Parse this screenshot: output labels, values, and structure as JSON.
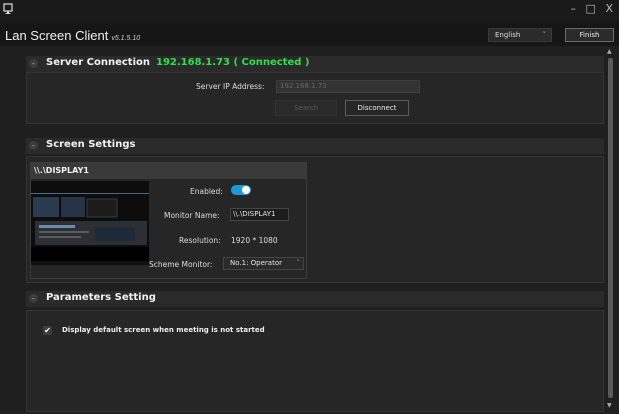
{
  "window": {
    "app_icon": "monitor-icon",
    "controls": {
      "minimize": "–",
      "maximize": "□",
      "close": "X"
    }
  },
  "header": {
    "title": "Lan Screen Client",
    "version": "v5.1.5.10",
    "language": "English",
    "finish_label": "Finish"
  },
  "server_connection": {
    "title": "Server Connection",
    "status": "192.168.1.73 ( Connected )",
    "ip_label": "Server IP Address:",
    "ip_value": "192.168.1.73",
    "search_label": "Search",
    "disconnect_label": "Disconnect",
    "status_color": "#2ee04a"
  },
  "screen_settings": {
    "title": "Screen Settings",
    "display": {
      "name": "\\\\.\\DISPLAY1",
      "enabled_label": "Enabled:",
      "enabled": true,
      "monitor_name_label": "Monitor Name:",
      "monitor_name": "\\\\.\\DISPLAY1",
      "resolution_label": "Resolution:",
      "resolution": "1920 * 1080",
      "scheme_label": "Scheme Monitor:",
      "scheme_value": "No.1: Operator"
    }
  },
  "parameters": {
    "title": "Parameters Setting",
    "checkbox_label": "Display default screen when meeting is not started",
    "checkbox_checked": true
  },
  "colors": {
    "toggle_on": "#1e9bd7",
    "background": "#1f1f1f"
  }
}
